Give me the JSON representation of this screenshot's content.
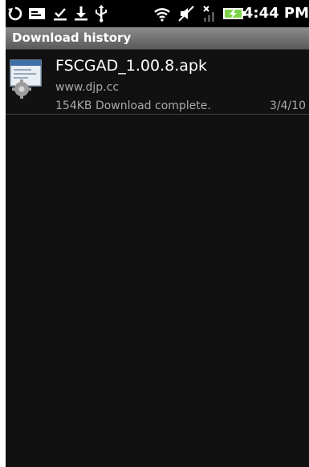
{
  "status_bar": {
    "time": "4:44 PM",
    "icons": [
      "sync-icon",
      "message-icon",
      "download-done-icon",
      "download-icon",
      "usb-icon",
      "wifi-icon",
      "vibrate-off-icon",
      "no-signal-icon",
      "battery-charging-icon"
    ],
    "accent": "#7cd34a"
  },
  "title_bar": {
    "title": "Download history"
  },
  "downloads": [
    {
      "filename": "FSCGAD_1.00.8.apk",
      "source": "www.djp.cc",
      "status": "154KB Download complete.",
      "date": "3/4/10",
      "icon": "apk-installer-icon"
    }
  ]
}
